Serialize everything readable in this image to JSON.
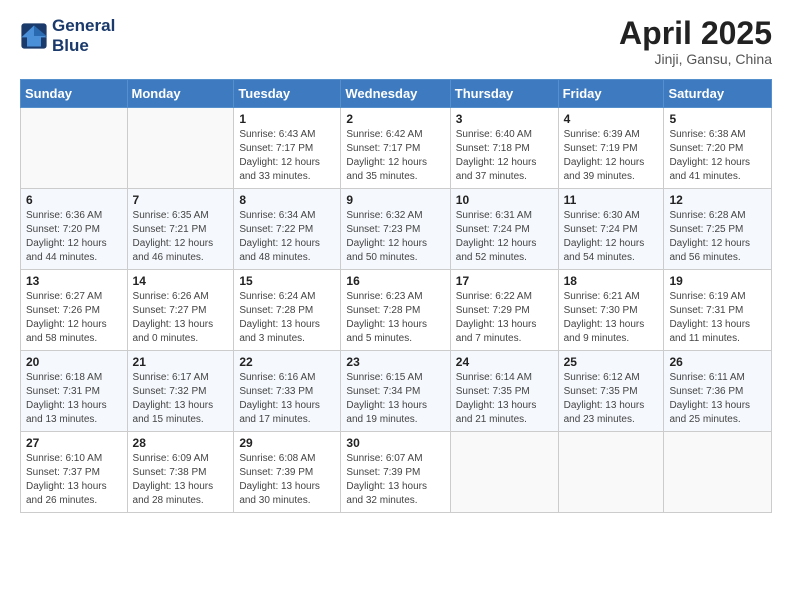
{
  "header": {
    "logo_line1": "General",
    "logo_line2": "Blue",
    "month_title": "April 2025",
    "location": "Jinji, Gansu, China"
  },
  "days_of_week": [
    "Sunday",
    "Monday",
    "Tuesday",
    "Wednesday",
    "Thursday",
    "Friday",
    "Saturday"
  ],
  "weeks": [
    [
      {
        "day": "",
        "sunrise": "",
        "sunset": "",
        "daylight": ""
      },
      {
        "day": "",
        "sunrise": "",
        "sunset": "",
        "daylight": ""
      },
      {
        "day": "1",
        "sunrise": "Sunrise: 6:43 AM",
        "sunset": "Sunset: 7:17 PM",
        "daylight": "Daylight: 12 hours and 33 minutes."
      },
      {
        "day": "2",
        "sunrise": "Sunrise: 6:42 AM",
        "sunset": "Sunset: 7:17 PM",
        "daylight": "Daylight: 12 hours and 35 minutes."
      },
      {
        "day": "3",
        "sunrise": "Sunrise: 6:40 AM",
        "sunset": "Sunset: 7:18 PM",
        "daylight": "Daylight: 12 hours and 37 minutes."
      },
      {
        "day": "4",
        "sunrise": "Sunrise: 6:39 AM",
        "sunset": "Sunset: 7:19 PM",
        "daylight": "Daylight: 12 hours and 39 minutes."
      },
      {
        "day": "5",
        "sunrise": "Sunrise: 6:38 AM",
        "sunset": "Sunset: 7:20 PM",
        "daylight": "Daylight: 12 hours and 41 minutes."
      }
    ],
    [
      {
        "day": "6",
        "sunrise": "Sunrise: 6:36 AM",
        "sunset": "Sunset: 7:20 PM",
        "daylight": "Daylight: 12 hours and 44 minutes."
      },
      {
        "day": "7",
        "sunrise": "Sunrise: 6:35 AM",
        "sunset": "Sunset: 7:21 PM",
        "daylight": "Daylight: 12 hours and 46 minutes."
      },
      {
        "day": "8",
        "sunrise": "Sunrise: 6:34 AM",
        "sunset": "Sunset: 7:22 PM",
        "daylight": "Daylight: 12 hours and 48 minutes."
      },
      {
        "day": "9",
        "sunrise": "Sunrise: 6:32 AM",
        "sunset": "Sunset: 7:23 PM",
        "daylight": "Daylight: 12 hours and 50 minutes."
      },
      {
        "day": "10",
        "sunrise": "Sunrise: 6:31 AM",
        "sunset": "Sunset: 7:24 PM",
        "daylight": "Daylight: 12 hours and 52 minutes."
      },
      {
        "day": "11",
        "sunrise": "Sunrise: 6:30 AM",
        "sunset": "Sunset: 7:24 PM",
        "daylight": "Daylight: 12 hours and 54 minutes."
      },
      {
        "day": "12",
        "sunrise": "Sunrise: 6:28 AM",
        "sunset": "Sunset: 7:25 PM",
        "daylight": "Daylight: 12 hours and 56 minutes."
      }
    ],
    [
      {
        "day": "13",
        "sunrise": "Sunrise: 6:27 AM",
        "sunset": "Sunset: 7:26 PM",
        "daylight": "Daylight: 12 hours and 58 minutes."
      },
      {
        "day": "14",
        "sunrise": "Sunrise: 6:26 AM",
        "sunset": "Sunset: 7:27 PM",
        "daylight": "Daylight: 13 hours and 0 minutes."
      },
      {
        "day": "15",
        "sunrise": "Sunrise: 6:24 AM",
        "sunset": "Sunset: 7:28 PM",
        "daylight": "Daylight: 13 hours and 3 minutes."
      },
      {
        "day": "16",
        "sunrise": "Sunrise: 6:23 AM",
        "sunset": "Sunset: 7:28 PM",
        "daylight": "Daylight: 13 hours and 5 minutes."
      },
      {
        "day": "17",
        "sunrise": "Sunrise: 6:22 AM",
        "sunset": "Sunset: 7:29 PM",
        "daylight": "Daylight: 13 hours and 7 minutes."
      },
      {
        "day": "18",
        "sunrise": "Sunrise: 6:21 AM",
        "sunset": "Sunset: 7:30 PM",
        "daylight": "Daylight: 13 hours and 9 minutes."
      },
      {
        "day": "19",
        "sunrise": "Sunrise: 6:19 AM",
        "sunset": "Sunset: 7:31 PM",
        "daylight": "Daylight: 13 hours and 11 minutes."
      }
    ],
    [
      {
        "day": "20",
        "sunrise": "Sunrise: 6:18 AM",
        "sunset": "Sunset: 7:31 PM",
        "daylight": "Daylight: 13 hours and 13 minutes."
      },
      {
        "day": "21",
        "sunrise": "Sunrise: 6:17 AM",
        "sunset": "Sunset: 7:32 PM",
        "daylight": "Daylight: 13 hours and 15 minutes."
      },
      {
        "day": "22",
        "sunrise": "Sunrise: 6:16 AM",
        "sunset": "Sunset: 7:33 PM",
        "daylight": "Daylight: 13 hours and 17 minutes."
      },
      {
        "day": "23",
        "sunrise": "Sunrise: 6:15 AM",
        "sunset": "Sunset: 7:34 PM",
        "daylight": "Daylight: 13 hours and 19 minutes."
      },
      {
        "day": "24",
        "sunrise": "Sunrise: 6:14 AM",
        "sunset": "Sunset: 7:35 PM",
        "daylight": "Daylight: 13 hours and 21 minutes."
      },
      {
        "day": "25",
        "sunrise": "Sunrise: 6:12 AM",
        "sunset": "Sunset: 7:35 PM",
        "daylight": "Daylight: 13 hours and 23 minutes."
      },
      {
        "day": "26",
        "sunrise": "Sunrise: 6:11 AM",
        "sunset": "Sunset: 7:36 PM",
        "daylight": "Daylight: 13 hours and 25 minutes."
      }
    ],
    [
      {
        "day": "27",
        "sunrise": "Sunrise: 6:10 AM",
        "sunset": "Sunset: 7:37 PM",
        "daylight": "Daylight: 13 hours and 26 minutes."
      },
      {
        "day": "28",
        "sunrise": "Sunrise: 6:09 AM",
        "sunset": "Sunset: 7:38 PM",
        "daylight": "Daylight: 13 hours and 28 minutes."
      },
      {
        "day": "29",
        "sunrise": "Sunrise: 6:08 AM",
        "sunset": "Sunset: 7:39 PM",
        "daylight": "Daylight: 13 hours and 30 minutes."
      },
      {
        "day": "30",
        "sunrise": "Sunrise: 6:07 AM",
        "sunset": "Sunset: 7:39 PM",
        "daylight": "Daylight: 13 hours and 32 minutes."
      },
      {
        "day": "",
        "sunrise": "",
        "sunset": "",
        "daylight": ""
      },
      {
        "day": "",
        "sunrise": "",
        "sunset": "",
        "daylight": ""
      },
      {
        "day": "",
        "sunrise": "",
        "sunset": "",
        "daylight": ""
      }
    ]
  ]
}
